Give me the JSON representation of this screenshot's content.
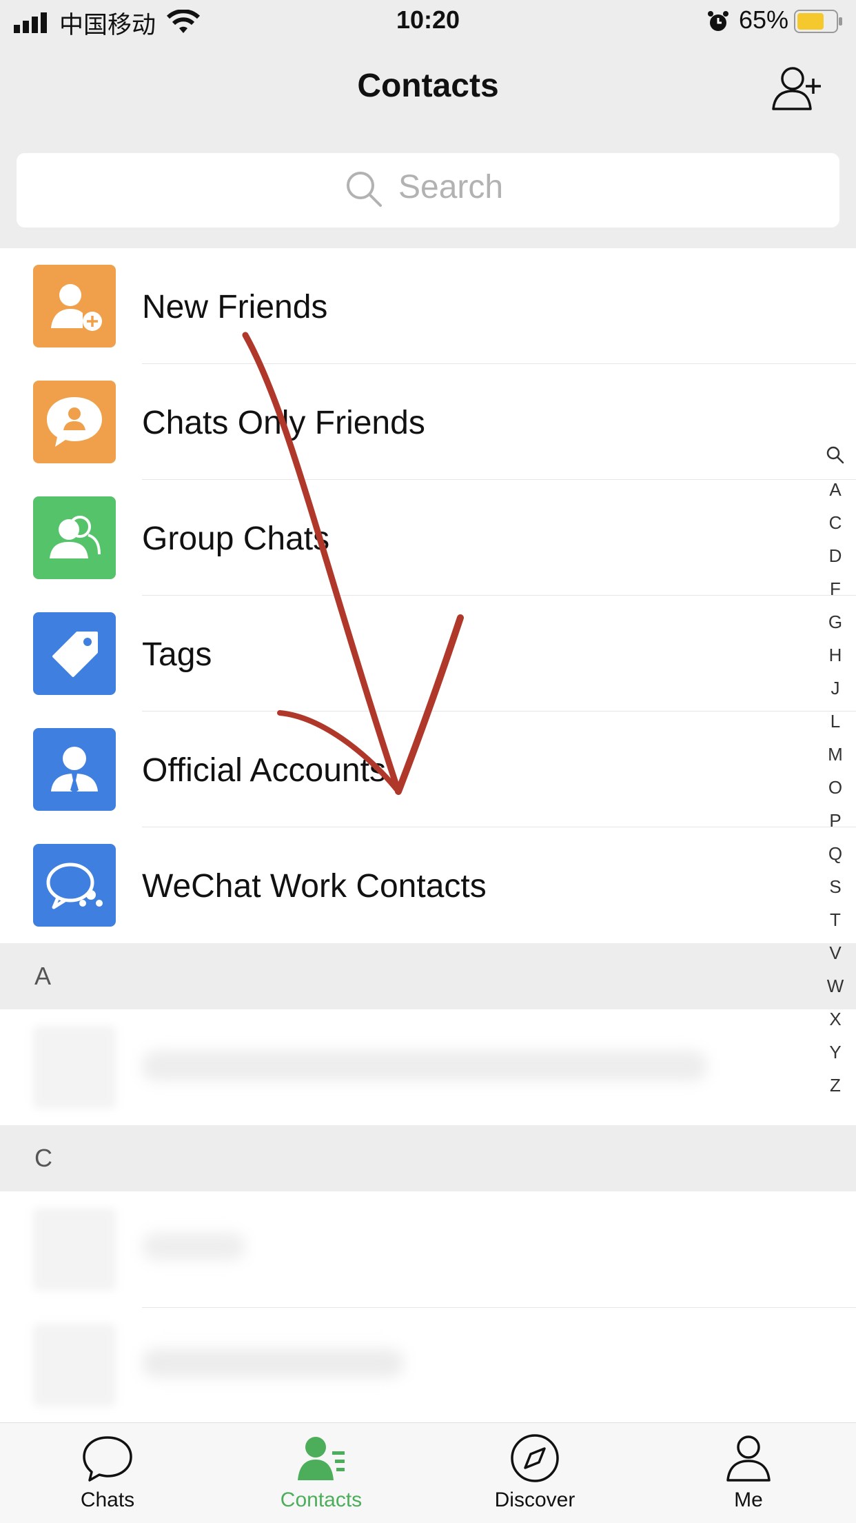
{
  "status_bar": {
    "carrier": "中国移动",
    "time": "10:20",
    "battery": "65%"
  },
  "nav": {
    "title": "Contacts"
  },
  "search": {
    "placeholder": "Search"
  },
  "fixed_rows": [
    {
      "label": "New Friends",
      "icon": "new-friends-icon",
      "color": "#f0a04b"
    },
    {
      "label": "Chats Only Friends",
      "icon": "chats-only-friends-icon",
      "color": "#f0a04b"
    },
    {
      "label": "Group Chats",
      "icon": "group-chats-icon",
      "color": "#55c36a"
    },
    {
      "label": "Tags",
      "icon": "tag-icon",
      "color": "#3f7fe0"
    },
    {
      "label": "Official Accounts",
      "icon": "official-accounts-icon",
      "color": "#3f7fe0"
    },
    {
      "label": "WeChat Work Contacts",
      "icon": "wechat-work-icon",
      "color": "#3f7fe0"
    }
  ],
  "sections": [
    {
      "letter": "A"
    },
    {
      "letter": "C"
    }
  ],
  "index_letters": [
    "A",
    "C",
    "D",
    "F",
    "G",
    "H",
    "J",
    "L",
    "M",
    "O",
    "P",
    "Q",
    "S",
    "T",
    "V",
    "W",
    "X",
    "Y",
    "Z"
  ],
  "tabs": [
    {
      "label": "Chats",
      "icon": "chat-bubble-icon",
      "active": false
    },
    {
      "label": "Contacts",
      "icon": "contacts-icon",
      "active": true
    },
    {
      "label": "Discover",
      "icon": "compass-icon",
      "active": false
    },
    {
      "label": "Me",
      "icon": "person-icon",
      "active": false
    }
  ],
  "colors": {
    "accent": "#4cae5a",
    "annotation_arrow": "#b0382a"
  }
}
